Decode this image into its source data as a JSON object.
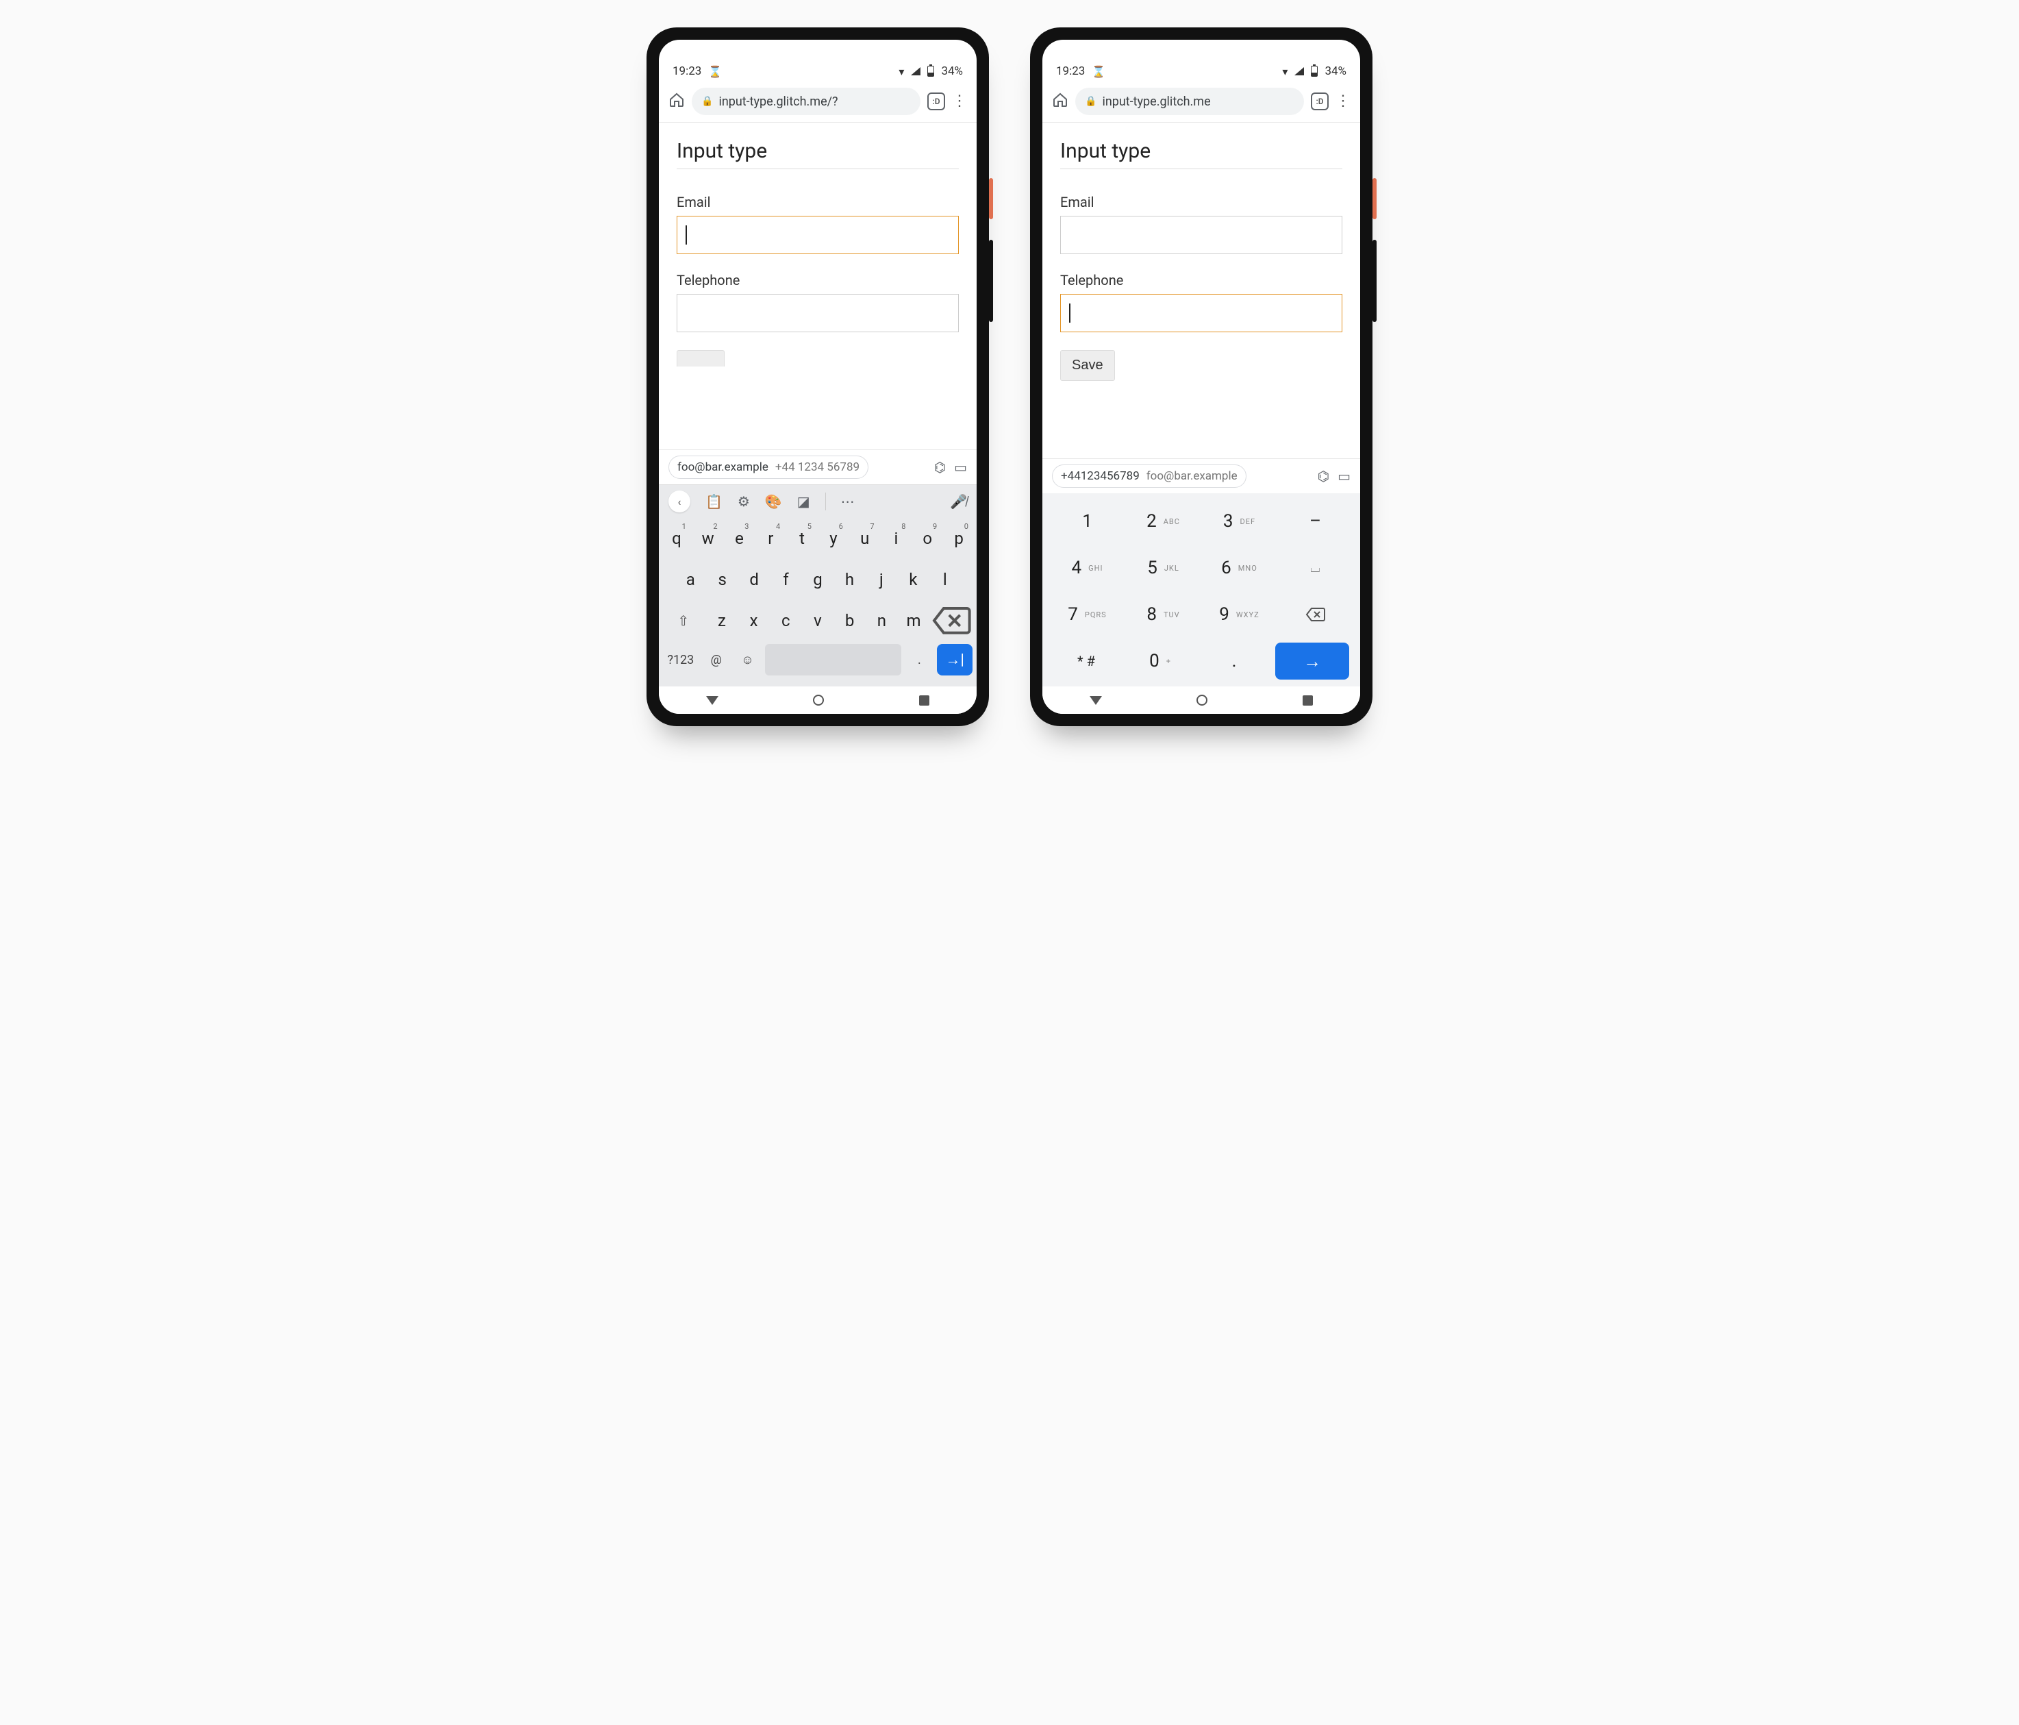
{
  "status": {
    "time": "19:23",
    "battery": "34%"
  },
  "browser": {
    "url_left": "input-type.glitch.me/?",
    "url_right": "input-type.glitch.me",
    "tab_label": ":D"
  },
  "page": {
    "heading": "Input type",
    "email_label": "Email",
    "tel_label": "Telephone",
    "save_label": "Save"
  },
  "autofill": {
    "email": "foo@bar.example",
    "phone_spaced": "+44 1234 56789",
    "phone_compact": "+44123456789"
  },
  "qwerty": {
    "row1": [
      "q",
      "w",
      "e",
      "r",
      "t",
      "y",
      "u",
      "i",
      "o",
      "p"
    ],
    "row1_sup": [
      "1",
      "2",
      "3",
      "4",
      "5",
      "6",
      "7",
      "8",
      "9",
      "0"
    ],
    "row2": [
      "a",
      "s",
      "d",
      "f",
      "g",
      "h",
      "j",
      "k",
      "l"
    ],
    "row3": [
      "z",
      "x",
      "c",
      "v",
      "b",
      "n",
      "m"
    ],
    "sym": "?123",
    "at": "@",
    "dot": "."
  },
  "numpad": {
    "keys": [
      [
        "1",
        ""
      ],
      [
        "2",
        "ABC"
      ],
      [
        "3",
        "DEF"
      ],
      [
        "4",
        "GHI"
      ],
      [
        "5",
        "JKL"
      ],
      [
        "6",
        "MNO"
      ],
      [
        "7",
        "PQRS"
      ],
      [
        "8",
        "TUV"
      ],
      [
        "9",
        "WXYZ"
      ],
      [
        "* #",
        ""
      ],
      [
        "0",
        "+"
      ],
      [
        ".",
        ""
      ]
    ],
    "dash": "–",
    "space": "⎵"
  }
}
